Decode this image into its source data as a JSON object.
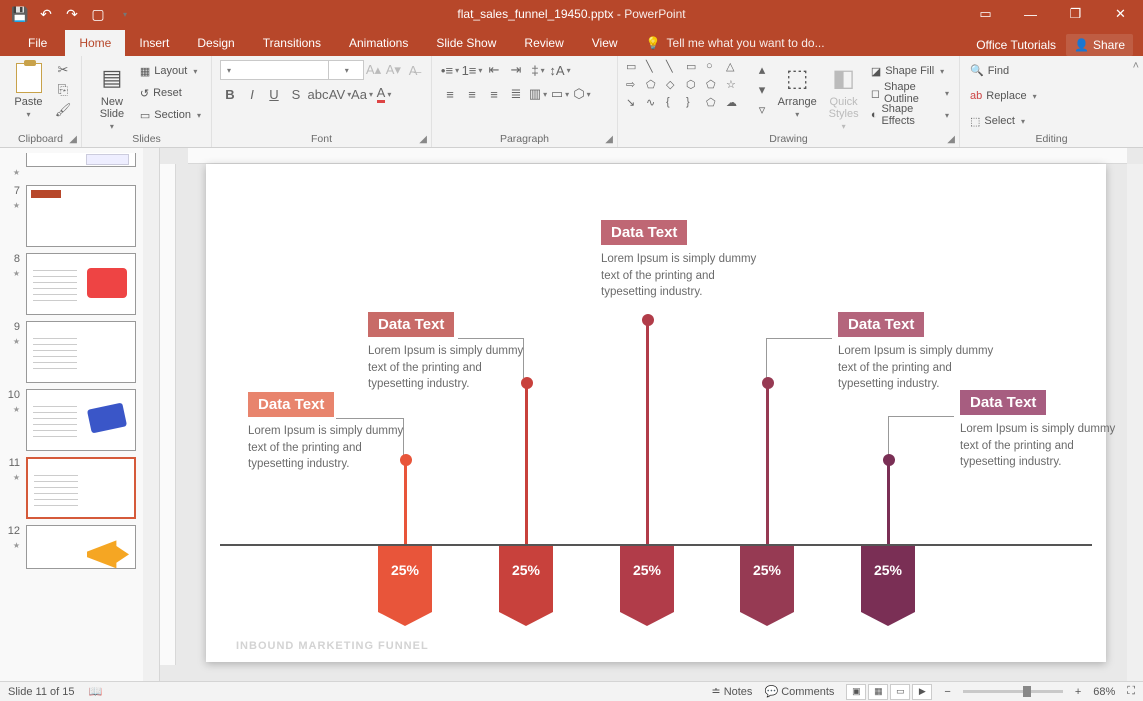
{
  "titlebar": {
    "doc": "flat_sales_funnel_19450.pptx",
    "app": "PowerPoint"
  },
  "tabs": {
    "file": "File",
    "home": "Home",
    "insert": "Insert",
    "design": "Design",
    "transitions": "Transitions",
    "animations": "Animations",
    "slideshow": "Slide Show",
    "review": "Review",
    "view": "View",
    "tellme": "Tell me what you want to do...",
    "tutorials": "Office Tutorials",
    "share": "Share"
  },
  "ribbon": {
    "clipboard": "Clipboard",
    "paste": "Paste",
    "slides": "Slides",
    "newslide": "New Slide",
    "layout": "Layout",
    "reset": "Reset",
    "section": "Section",
    "font": "Font",
    "paragraph": "Paragraph",
    "drawing": "Drawing",
    "arrange": "Arrange",
    "quick": "Quick Styles",
    "shapefill": "Shape Fill",
    "shapeoutline": "Shape Outline",
    "shapeeffects": "Shape Effects",
    "editing": "Editing",
    "find": "Find",
    "replace": "Replace",
    "select": "Select"
  },
  "thumbs": [
    {
      "n": "7"
    },
    {
      "n": "8"
    },
    {
      "n": "9"
    },
    {
      "n": "10"
    },
    {
      "n": "11"
    },
    {
      "n": "12"
    }
  ],
  "slide": {
    "title": "INBOUND MARKETING FUNNEL",
    "items": [
      {
        "label": "Data Text",
        "desc": "Lorem Ipsum is simply dummy text of the printing and typesetting industry.",
        "pct": "25%"
      },
      {
        "label": "Data Text",
        "desc": "Lorem Ipsum is simply dummy text of the printing and typesetting industry.",
        "pct": "25%"
      },
      {
        "label": "Data Text",
        "desc": "Lorem Ipsum is simply dummy text of the printing and typesetting industry.",
        "pct": "25%"
      },
      {
        "label": "Data Text",
        "desc": "Lorem Ipsum is simply dummy text of the printing and typesetting industry.",
        "pct": "25%"
      },
      {
        "label": "Data Text",
        "desc": "Lorem Ipsum is simply dummy text of the printing and typesetting industry.",
        "pct": "25%"
      }
    ]
  },
  "status": {
    "slide": "Slide 11 of 15",
    "notes": "Notes",
    "comments": "Comments",
    "zoom": "68%"
  }
}
